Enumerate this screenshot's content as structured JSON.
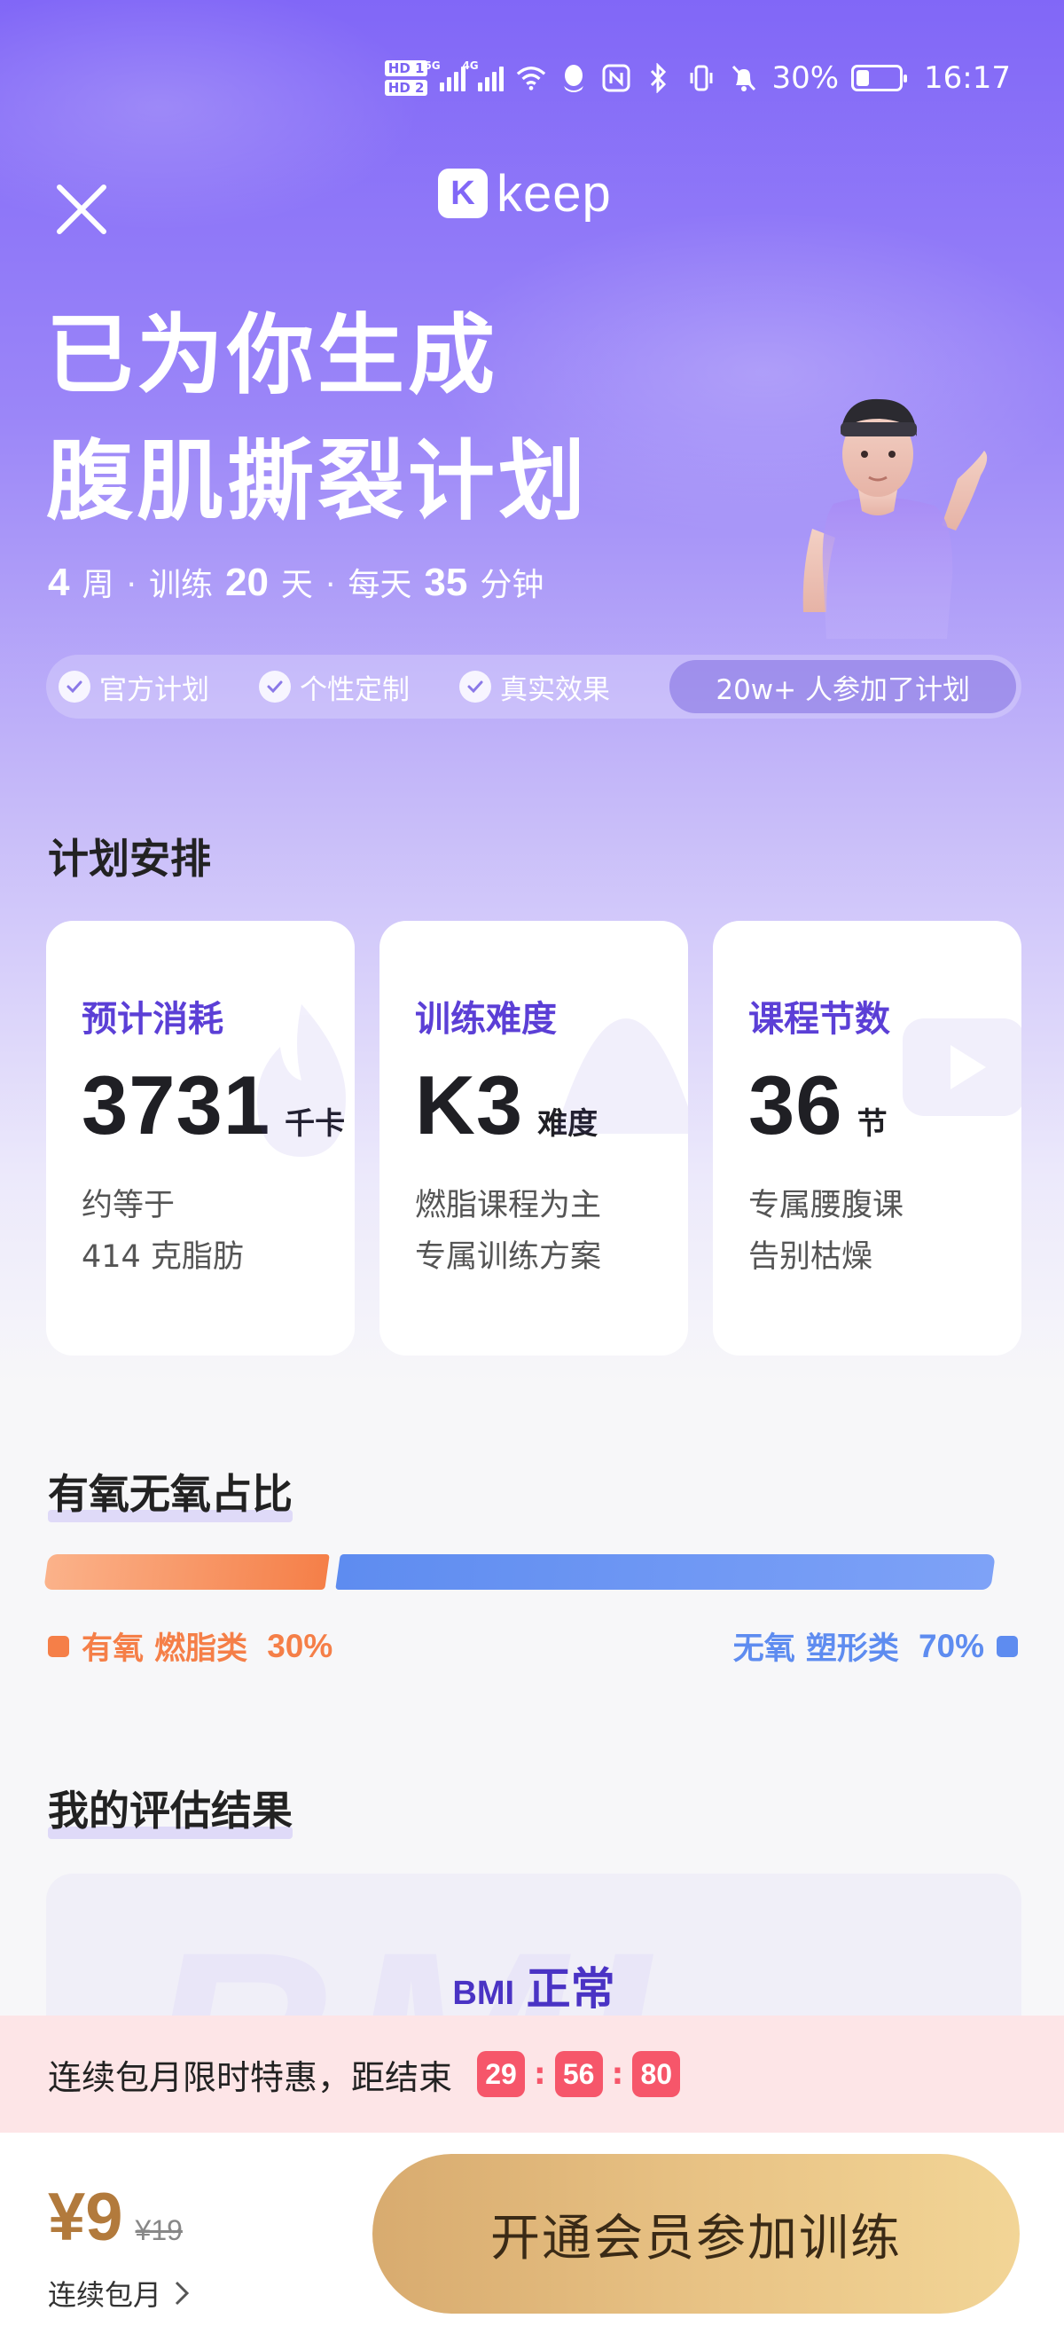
{
  "status_bar": {
    "hd1": "HD 1",
    "hd2": "HD 2",
    "net1": "5G",
    "net2": "4G",
    "battery_pct": "30%",
    "battery_level": 0.3,
    "time": "16:17"
  },
  "header": {
    "logo_mark": "K",
    "logo_text": "keep"
  },
  "hero": {
    "title_line1": "已为你生成",
    "title_line2": "腹肌撕裂计划",
    "weeks_num": "4",
    "weeks_unit": "周",
    "dot": "·",
    "days_label": "训练",
    "days_num": "20",
    "days_unit": "天",
    "daily_label": "每天",
    "daily_num": "35",
    "daily_unit": "分钟"
  },
  "tags": [
    "官方计划",
    "个性定制",
    "真实效果"
  ],
  "tags_pill": "20w+ 人参加了计划",
  "plan_section": {
    "title": "计划安排",
    "cards": [
      {
        "label": "预计消耗",
        "value": "3731",
        "unit": "千卡",
        "desc1": "约等于",
        "desc2": "414 克脂肪"
      },
      {
        "label": "训练难度",
        "value": "K3",
        "unit": "难度",
        "desc1": "燃脂课程为主",
        "desc2": "专属训练方案"
      },
      {
        "label": "课程节数",
        "value": "36",
        "unit": "节",
        "desc1": "专属腰腹课",
        "desc2": "告别枯燥"
      }
    ]
  },
  "ratio_section": {
    "title": "有氧无氧占比",
    "aerobic": {
      "label": "有氧 燃脂类",
      "pct_text": "30%",
      "fraction": 0.3,
      "color": "#f57f48"
    },
    "anaerobic": {
      "label": "无氧 塑形类",
      "pct_text": "70%",
      "fraction": 0.7,
      "color": "#5e8cf0"
    }
  },
  "assessment_section": {
    "title": "我的评估结果",
    "watermark": "BMI",
    "bmi_key": "BMI",
    "bmi_value": "正常"
  },
  "promo": {
    "text": "连续包月限时特惠，距结束",
    "hours": "29",
    "minutes": "56",
    "seconds": "80",
    "sep": ":"
  },
  "bottom": {
    "price_now": "¥9",
    "price_old": "¥19",
    "plan_type": "连续包月",
    "cta": "开通会员参加训练"
  },
  "colors": {
    "brand_purple": "#8167f7",
    "accent_text": "#5b3fd6",
    "promo_red": "#f6566a",
    "gold": "#d8ab6f"
  }
}
